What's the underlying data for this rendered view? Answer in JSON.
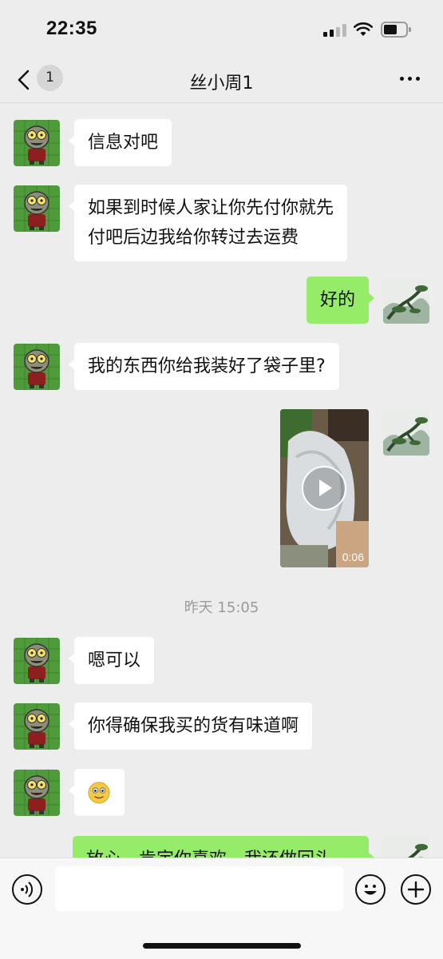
{
  "status_bar": {
    "time": "22:35"
  },
  "header": {
    "back_badge": "1",
    "title": "丝小周1"
  },
  "messages": [
    {
      "side": "in",
      "text": "信息对吧"
    },
    {
      "side": "in",
      "line1": "如果到时候人家让你先付你就先",
      "line2": "付吧后边我给你转过去运费"
    },
    {
      "side": "out",
      "text": "好的"
    },
    {
      "side": "in",
      "text": "我的东西你给我装好了袋子里?"
    },
    {
      "side": "out",
      "type": "video",
      "duration": "0:06"
    },
    {
      "type": "timestamp",
      "text": "昨天 15:05"
    },
    {
      "side": "in",
      "text": "嗯可以"
    },
    {
      "side": "in",
      "text": "你得确保我买的货有味道啊"
    },
    {
      "side": "in",
      "type": "emoji",
      "text": "🙂"
    },
    {
      "side": "out",
      "text": "放心，肯定你喜欢，我还做回头"
    }
  ],
  "input_bar": {
    "placeholder": ""
  },
  "colors": {
    "background": "#ededed",
    "outgoing_bubble": "#95ec69",
    "incoming_bubble": "#ffffff"
  }
}
